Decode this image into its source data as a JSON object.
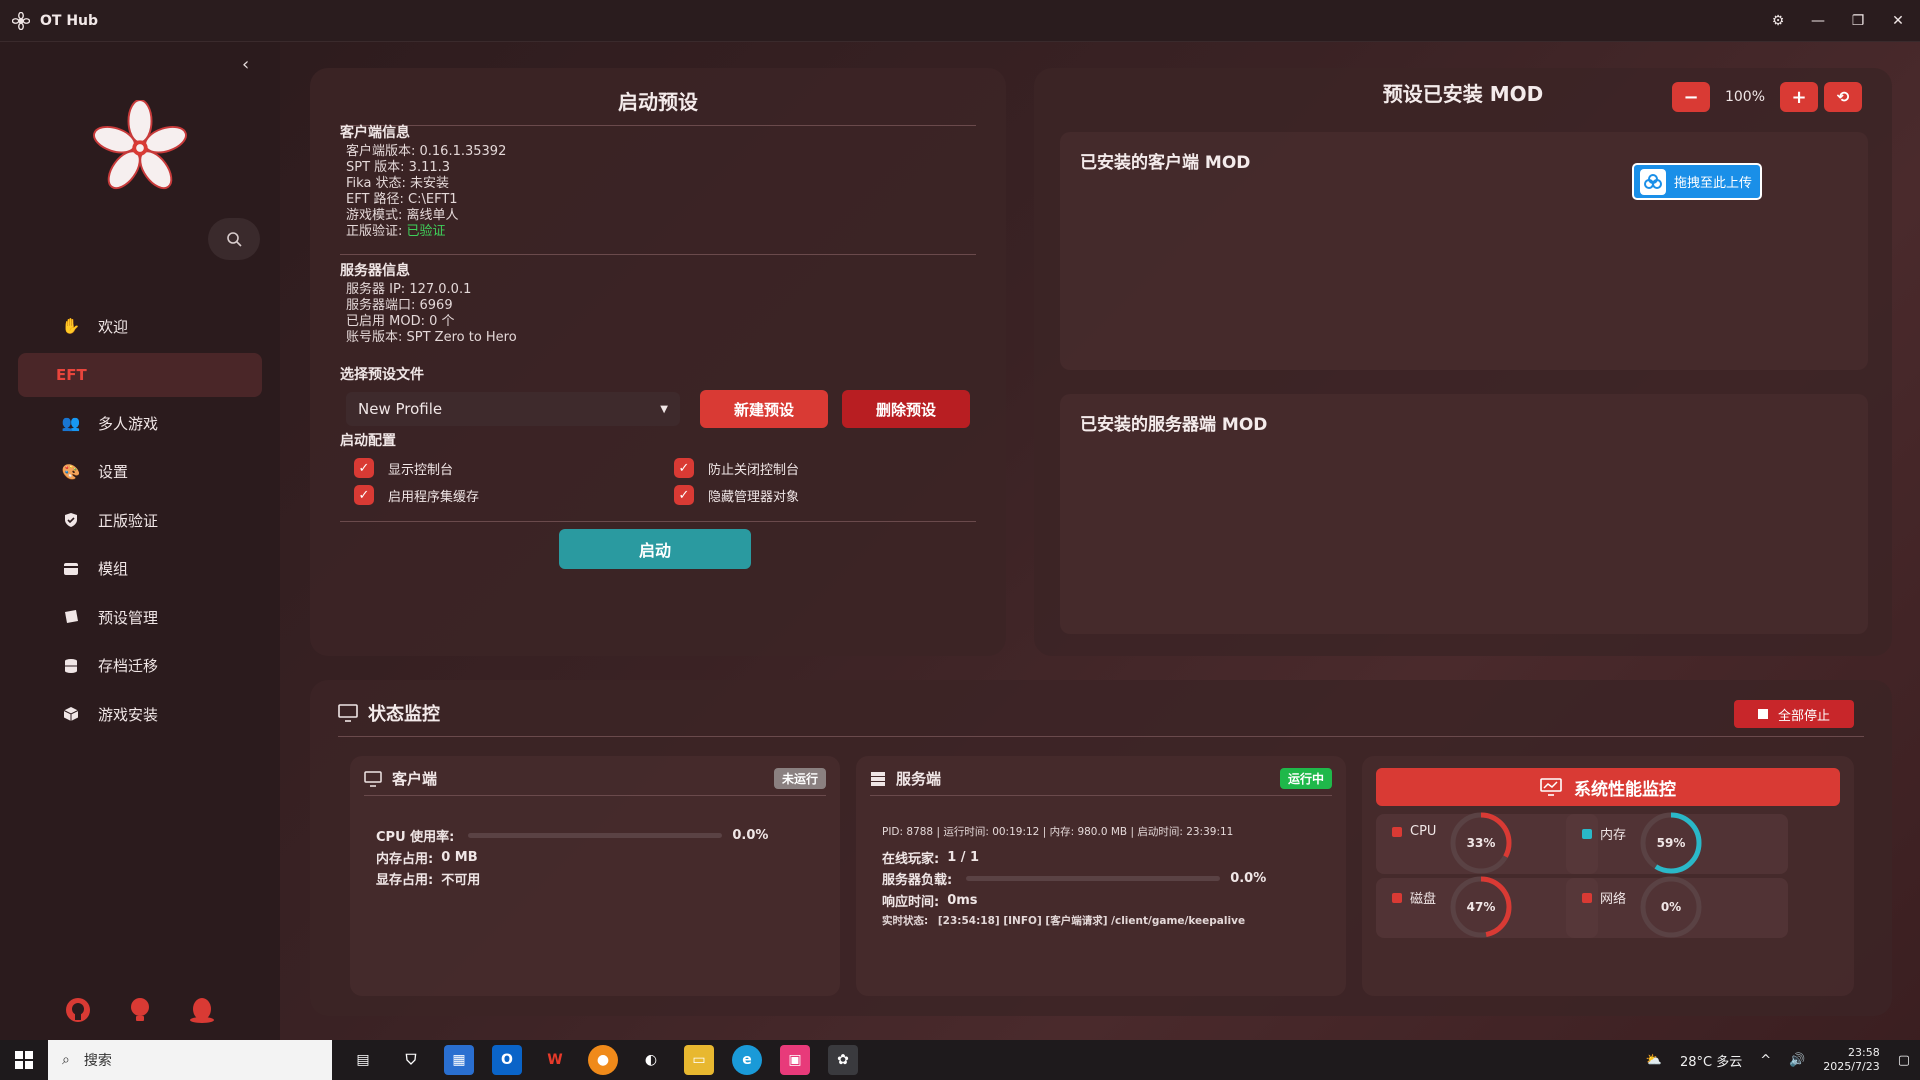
{
  "app": {
    "title": "OT Hub"
  },
  "sidebar": {
    "items": [
      {
        "label": "欢迎",
        "icon": "hand-icon"
      },
      {
        "label": "EFT",
        "icon": ""
      },
      {
        "label": "多人游戏",
        "icon": "users-icon"
      },
      {
        "label": "设置",
        "icon": "palette-icon"
      },
      {
        "label": "正版验证",
        "icon": "shield-icon"
      },
      {
        "label": "模组",
        "icon": "card-icon"
      },
      {
        "label": "预设管理",
        "icon": "bookmark-icon"
      },
      {
        "label": "存档迁移",
        "icon": "database-icon"
      },
      {
        "label": "游戏安装",
        "icon": "box-icon"
      }
    ]
  },
  "launch": {
    "title": "启动预设",
    "client_info": {
      "heading": "客户端信息",
      "lines": [
        "客户端版本: 0.16.1.35392",
        "SPT 版本: 3.11.3",
        "Fika 状态: 未安装",
        "EFT 路径: C:\\EFT1",
        "游戏模式: 离线单人"
      ],
      "verify_label": "正版验证: ",
      "verify_value": "已验证"
    },
    "server_info": {
      "heading": "服务器信息",
      "lines": [
        "服务器 IP: 127.0.0.1",
        "服务器端口: 6969",
        "已启用 MOD: 0 个",
        "账号版本: SPT Zero to Hero"
      ]
    },
    "profile_heading": "选择预设文件",
    "profile_selected": "New Profile",
    "new_preset": "新建预设",
    "delete_preset": "删除预设",
    "config_heading": "启动配置",
    "options": [
      {
        "label": "显示控制台",
        "checked": true
      },
      {
        "label": "防止关闭控制台",
        "checked": true
      },
      {
        "label": "启用程序集缓存",
        "checked": true
      },
      {
        "label": "隐藏管理器对象",
        "checked": true
      }
    ],
    "launch_button": "启动"
  },
  "mods": {
    "title": "预设已安装 MOD",
    "zoom": "100%",
    "client_title": "已安装的客户端 MOD",
    "server_title": "已安装的服务器端 MOD",
    "upload_label": "拖拽至此上传"
  },
  "status": {
    "title": "状态监控",
    "stop_all": "全部停止",
    "client": {
      "title": "客户端",
      "badge": "未运行",
      "cpu_label": "CPU 使用率:",
      "cpu_value": "0.0%",
      "cpu_fraction": 0,
      "mem_label": "内存占用:",
      "mem_value": "0 MB",
      "vram_label": "显存占用:",
      "vram_value": "不可用"
    },
    "server": {
      "title": "服务端",
      "badge": "运行中",
      "summary": "PID: 8788 | 运行时间: 00:19:12 | 内存: 980.0 MB | 启动时间: 23:39:11",
      "players_label": "在线玩家:",
      "players_value": "1 / 1",
      "load_label": "服务器负载:",
      "load_value": "0.0%",
      "load_fraction": 0,
      "resp_label": "响应时间:",
      "resp_value": "0ms",
      "live_label": "实时状态:",
      "live_value": "[23:54:18] [INFO] [客户端请求] /client/game/keepalive"
    },
    "perf": {
      "title": "系统性能监控",
      "gauges": [
        {
          "label": "CPU",
          "value": "33%",
          "fraction": 0.33,
          "color": "#d93a34",
          "icon": "cpu-icon"
        },
        {
          "label": "内存",
          "value": "59%",
          "fraction": 0.59,
          "color": "#2ab8c8",
          "icon": "memory-icon"
        },
        {
          "label": "磁盘",
          "value": "47%",
          "fraction": 0.47,
          "color": "#d93a34",
          "icon": "disk-icon"
        },
        {
          "label": "网络",
          "value": "0%",
          "fraction": 0.0,
          "color": "#d93a34",
          "icon": "network-icon"
        }
      ]
    }
  },
  "taskbar": {
    "search_placeholder": "搜索",
    "weather": "28°C 多云",
    "time": "23:58",
    "date": "2025/7/23"
  }
}
